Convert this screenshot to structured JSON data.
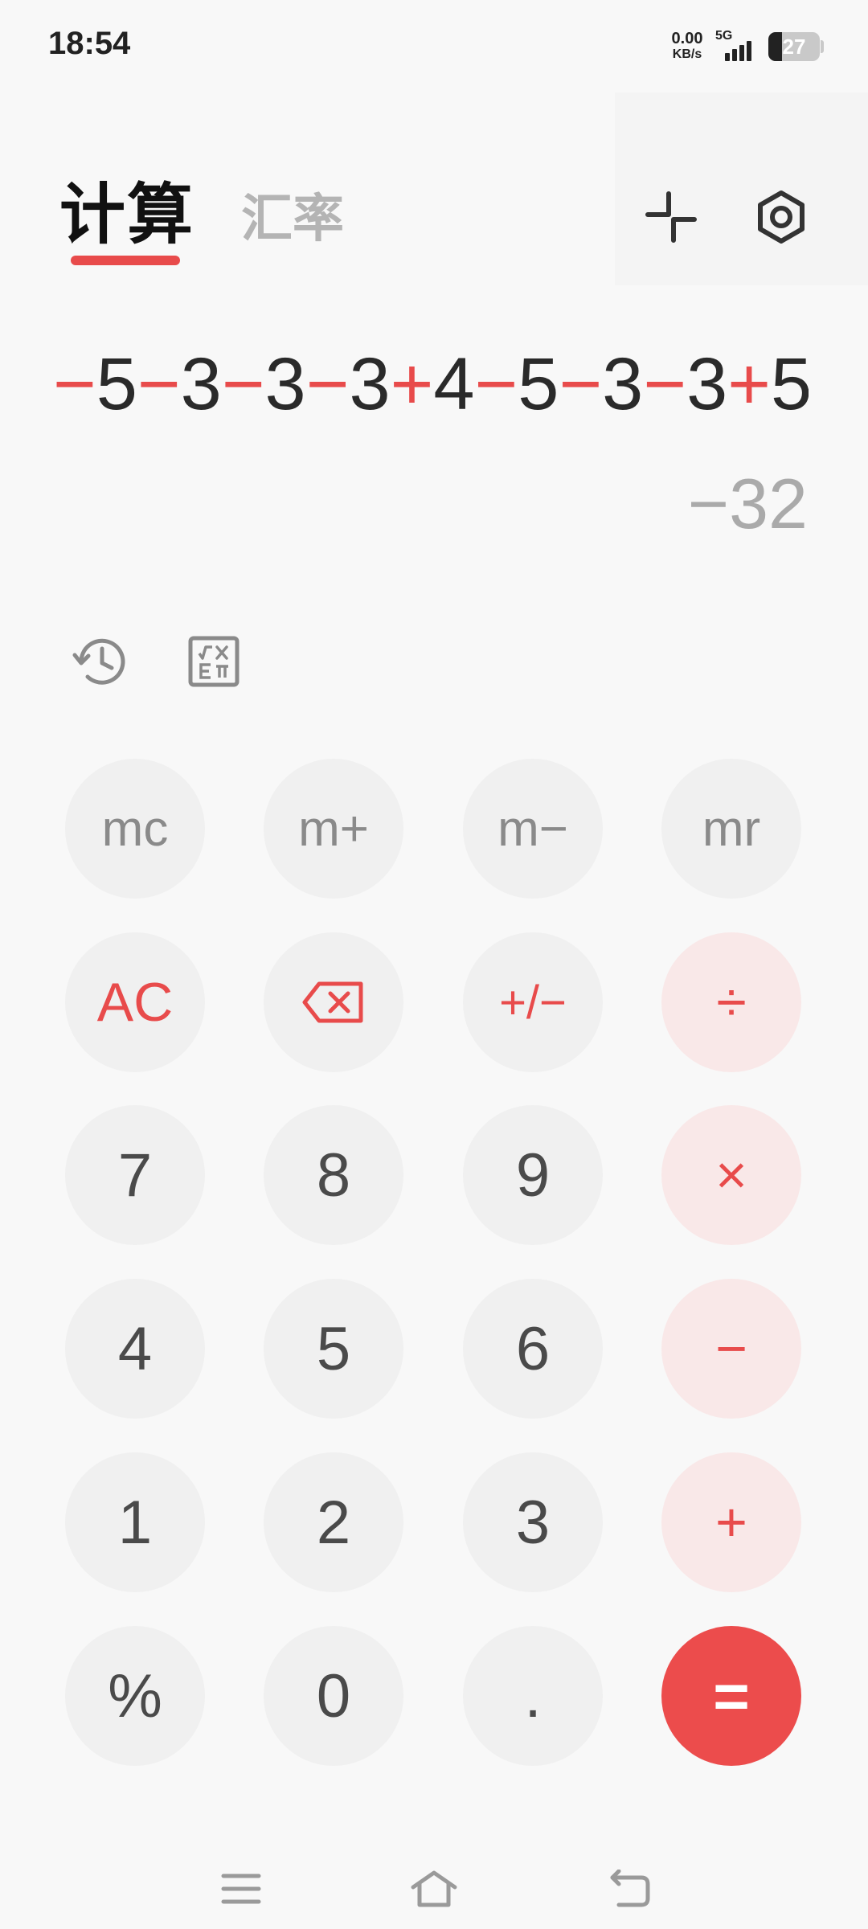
{
  "status_bar": {
    "time": "18:54",
    "net_speed_value": "0.00",
    "net_speed_unit": "KB/s",
    "signal_type": "5G",
    "signal_bars": 4,
    "battery_percent": "27",
    "battery_level": 0.27
  },
  "header": {
    "tab_calculate": "计算",
    "tab_exchange": "汇率",
    "collapse_icon": "collapse-icon",
    "settings_icon": "hexagon-settings-icon"
  },
  "display": {
    "expression_tokens": [
      {
        "t": "−",
        "op": true
      },
      {
        "t": "5",
        "op": false
      },
      {
        "t": "−",
        "op": true
      },
      {
        "t": "3",
        "op": false
      },
      {
        "t": "−",
        "op": true
      },
      {
        "t": "3",
        "op": false
      },
      {
        "t": "−",
        "op": true
      },
      {
        "t": "3",
        "op": false
      },
      {
        "t": "+",
        "op": true
      },
      {
        "t": "4",
        "op": false
      },
      {
        "t": "−",
        "op": true
      },
      {
        "t": "5",
        "op": false
      },
      {
        "t": "−",
        "op": true
      },
      {
        "t": "3",
        "op": false
      },
      {
        "t": "−",
        "op": true
      },
      {
        "t": "3",
        "op": false
      },
      {
        "t": "+",
        "op": true
      },
      {
        "t": "5",
        "op": false
      }
    ],
    "result": "−32"
  },
  "tools": {
    "history_icon": "history-icon",
    "scientific_icon": "scientific-mode-icon"
  },
  "keypad": {
    "mc": "mc",
    "m_plus": "m+",
    "m_minus": "m−",
    "mr": "mr",
    "ac": "AC",
    "plus_minus": "+/−",
    "divide": "÷",
    "seven": "7",
    "eight": "8",
    "nine": "9",
    "multiply": "×",
    "four": "4",
    "five": "5",
    "six": "6",
    "minus": "−",
    "one": "1",
    "two": "2",
    "three": "3",
    "plus": "+",
    "percent": "%",
    "zero": "0",
    "decimal": ".",
    "equals": "="
  },
  "colors": {
    "accent": "#e84b4b",
    "operator_bg": "#f9e8e8",
    "key_bg": "#f0f0f0",
    "background": "#f8f8f8"
  }
}
